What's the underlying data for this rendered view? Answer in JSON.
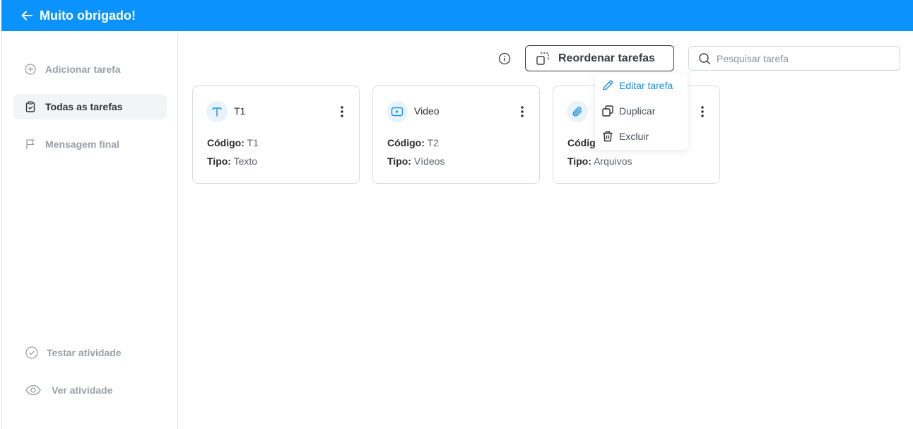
{
  "header": {
    "title": "Muito obrigado!"
  },
  "sidebar": {
    "items": [
      {
        "label": "Adicionar tarefa"
      },
      {
        "label": "Todas as tarefas"
      },
      {
        "label": "Mensagem final"
      }
    ],
    "bottom_items": [
      {
        "label": "Testar atividade"
      },
      {
        "label": "Ver atividade"
      }
    ]
  },
  "toolbar": {
    "reorder_label": "Reordenar tarefas",
    "search_placeholder": "Pesquisar tarefa"
  },
  "tasks": [
    {
      "title": "T1",
      "code_label": "Código:",
      "code": "T1",
      "type_label": "Tipo:",
      "type": "Texto",
      "icon": "text-icon"
    },
    {
      "title": "Video",
      "code_label": "Código:",
      "code": "T2",
      "type_label": "Tipo:",
      "type": "Vídeos",
      "icon": "video-icon"
    },
    {
      "title": "",
      "code_label": "Códig",
      "code": "",
      "type_label": "Tipo:",
      "type": "Arquivos",
      "icon": "paperclip-icon"
    }
  ],
  "context_menu": {
    "items": [
      {
        "label": "Editar tarefa"
      },
      {
        "label": "Duplicar"
      },
      {
        "label": "Excluir"
      }
    ]
  },
  "colors": {
    "accent": "#0a93ff",
    "highlight": "#1a8fe0"
  }
}
